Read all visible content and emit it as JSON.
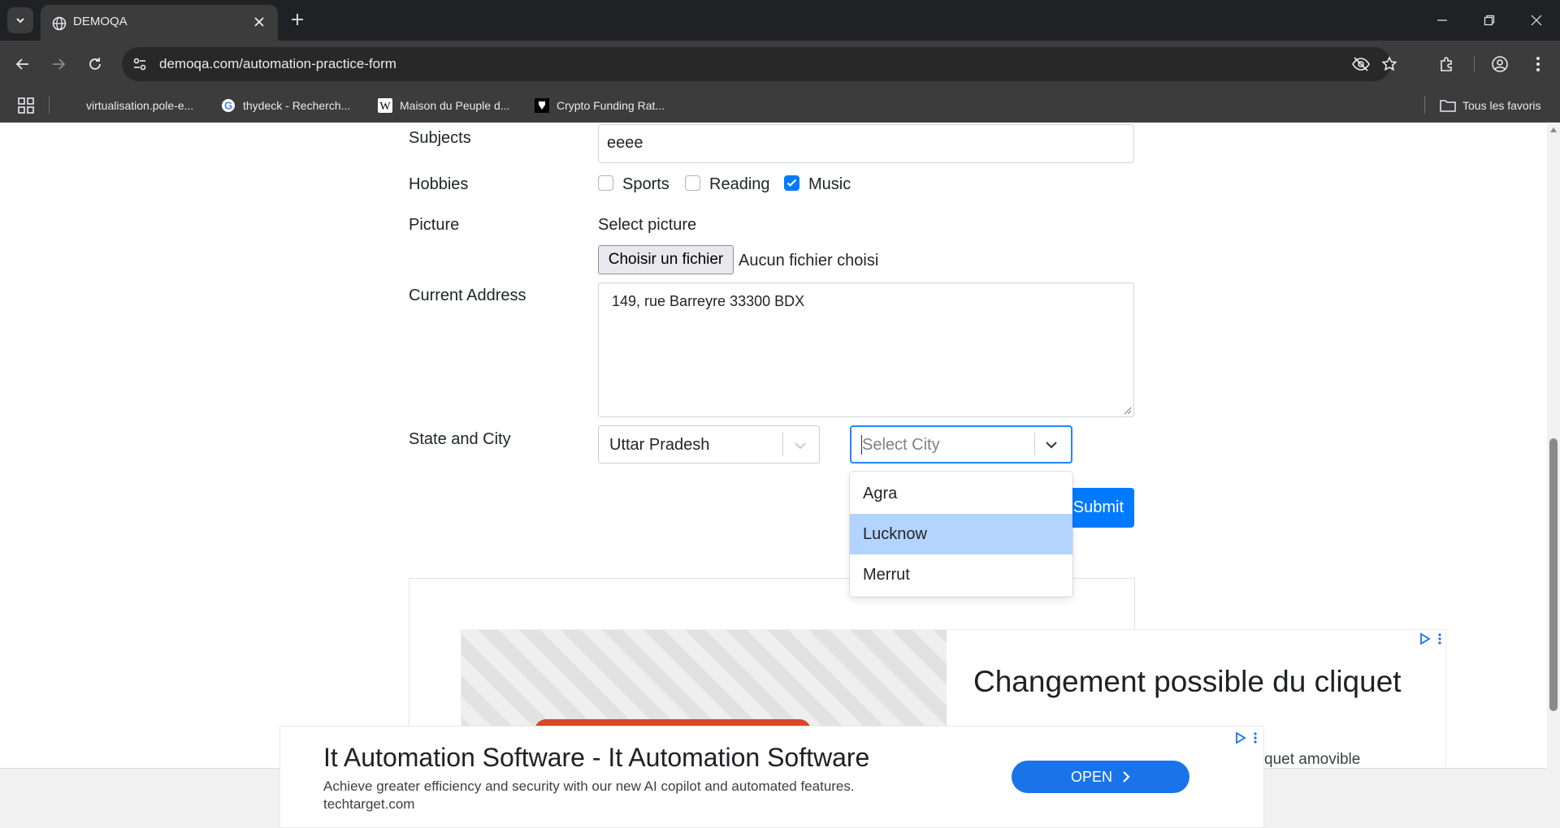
{
  "browser": {
    "tab_title": "DEMOQA",
    "url": "demoqa.com/automation-practice-form",
    "bookmarks": [
      {
        "label": "virtualisation.pole-e..."
      },
      {
        "label": "thydeck - Recherch..."
      },
      {
        "label": "Maison du Peuple d..."
      },
      {
        "label": "Crypto Funding Rat..."
      }
    ],
    "all_bookmarks": "Tous les favoris"
  },
  "form": {
    "subjects_label": "Subjects",
    "subjects_value": "eeee",
    "hobbies_label": "Hobbies",
    "hobbies": [
      {
        "label": "Sports",
        "checked": false
      },
      {
        "label": "Reading",
        "checked": false
      },
      {
        "label": "Music",
        "checked": true
      }
    ],
    "picture_label": "Picture",
    "select_picture": "Select picture",
    "file_button": "Choisir un fichier",
    "file_status": "Aucun fichier choisi",
    "address_label": "Current Address",
    "address_value": "149, rue Barreyre 33300 BDX",
    "state_city_label": "State and City",
    "state_value": "Uttar Pradesh",
    "city_placeholder": "Select City",
    "city_options": [
      "Agra",
      "Lucknow",
      "Merrut"
    ],
    "city_focused_option": "Lucknow",
    "submit_label": "Submit"
  },
  "ad": {
    "headline": "Changement possible du cliquet",
    "sub_partial": "quet amovible"
  },
  "bottom_ad": {
    "title": "It Automation Software - It Automation Software",
    "description": "Achieve greater efficiency and security with our new AI copilot and automated features.",
    "domain": "techtarget.com",
    "button": "OPEN"
  },
  "colors": {
    "accent": "#007bff",
    "option_focus": "#b2d4ff",
    "chrome_dark": "#202124"
  }
}
